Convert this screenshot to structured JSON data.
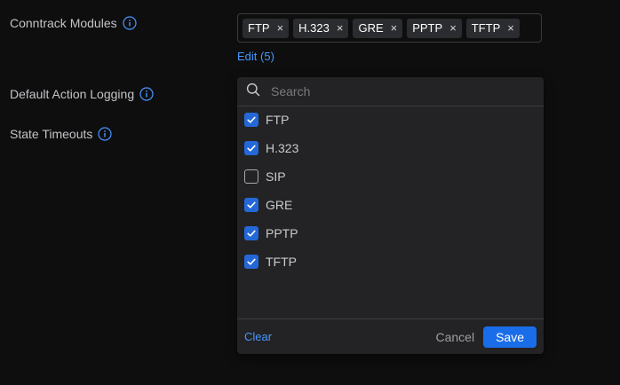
{
  "fields": {
    "conntrack_label": "Conntrack Modules",
    "logging_label": "Default Action Logging",
    "timeouts_label": "State Timeouts"
  },
  "tags": [
    "FTP",
    "H.323",
    "GRE",
    "PPTP",
    "TFTP"
  ],
  "tag_remove_glyph": "×",
  "edit_link": "Edit (5)",
  "dropdown": {
    "search_placeholder": "Search",
    "options": [
      {
        "label": "FTP",
        "checked": true
      },
      {
        "label": "H.323",
        "checked": true
      },
      {
        "label": "SIP",
        "checked": false
      },
      {
        "label": "GRE",
        "checked": true
      },
      {
        "label": "PPTP",
        "checked": true
      },
      {
        "label": "TFTP",
        "checked": true
      }
    ],
    "clear_label": "Clear",
    "cancel_label": "Cancel",
    "save_label": "Save"
  },
  "colors": {
    "accent": "#4797ff",
    "checkbox_checked": "#2468d8",
    "save_button": "#1a6de8",
    "background": "#0e0e0f",
    "panel": "#232325"
  }
}
